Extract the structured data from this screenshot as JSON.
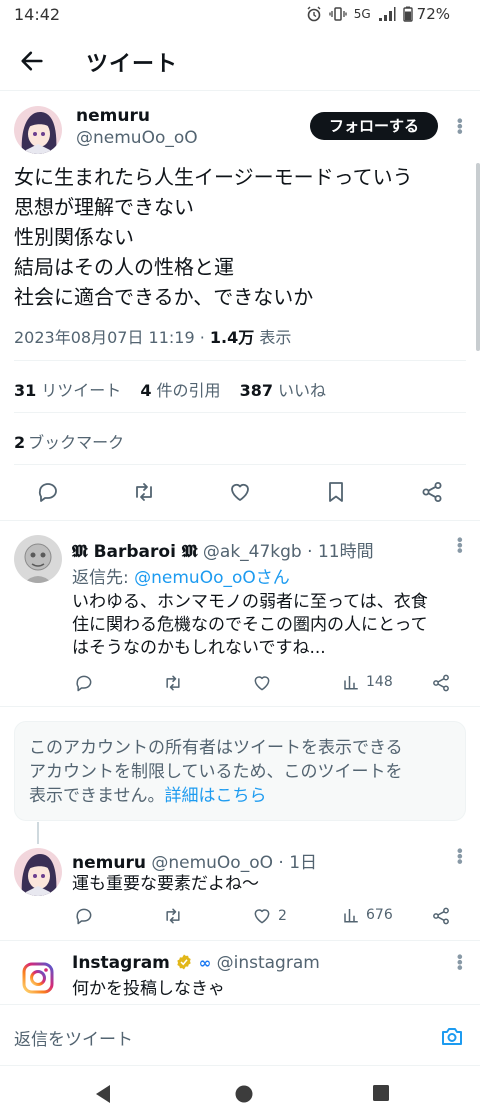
{
  "status_bar": {
    "time": "14:42",
    "network": "5G",
    "battery": "72%"
  },
  "header": {
    "title": "ツイート"
  },
  "tweet": {
    "name": "nemuru",
    "handle": "@nemuOo_oO",
    "follow_label": "フォローする",
    "lines": [
      "女に生まれたら人生イージーモードっていう",
      "思想が理解できない",
      "性別関係ない",
      "結局はその人の性格と運",
      "社会に適合できるか、できないか"
    ],
    "date": "2023年08月07日 11:19 · ",
    "views_count": "1.4万",
    "views_label": " 表示",
    "retweets_count": "31",
    "retweets_label": "リツイート",
    "quotes_count": "4",
    "quotes_label": "件の引用",
    "likes_count": "387",
    "likes_label": "いいね",
    "bookmarks_count": "2",
    "bookmarks_label": "ブックマーク"
  },
  "replies": [
    {
      "name": "𝕸 Barbaroi 𝕸",
      "handle": "@ak_47kgb",
      "time": " · 11時間",
      "reply_to_label": "返信先: ",
      "reply_to_handle": "@nemuOo_oOさん",
      "lines": [
        "いわゆる、ホンマモノの弱者に至っては、衣食",
        "住に関わる危機なのでそこの圏内の人にとって",
        "はそうなのかもしれないですね..."
      ],
      "likes": "",
      "views": "148"
    },
    {
      "name": "nemuru",
      "handle": "@nemuOo_oO",
      "time": " · 1日",
      "lines": [
        "運も重要な要素だよね〜"
      ],
      "likes": "2",
      "views": "676"
    },
    {
      "name": "Instagram",
      "handle": "@instagram",
      "lines": [
        "何かを投稿しなきゃ"
      ]
    }
  ],
  "notice": {
    "text_1": "このアカウントの所有者はツイートを表示できる",
    "text_2": "アカウントを制限しているため、このツイートを",
    "text_3": "表示できません。",
    "link": "詳細はこちら"
  },
  "reply_bar": {
    "placeholder": "返信をツイート"
  },
  "colors": {
    "accent": "#1d9bf0",
    "text": "#0f1419",
    "muted": "#536471",
    "verified_gold": "#e2b719"
  }
}
